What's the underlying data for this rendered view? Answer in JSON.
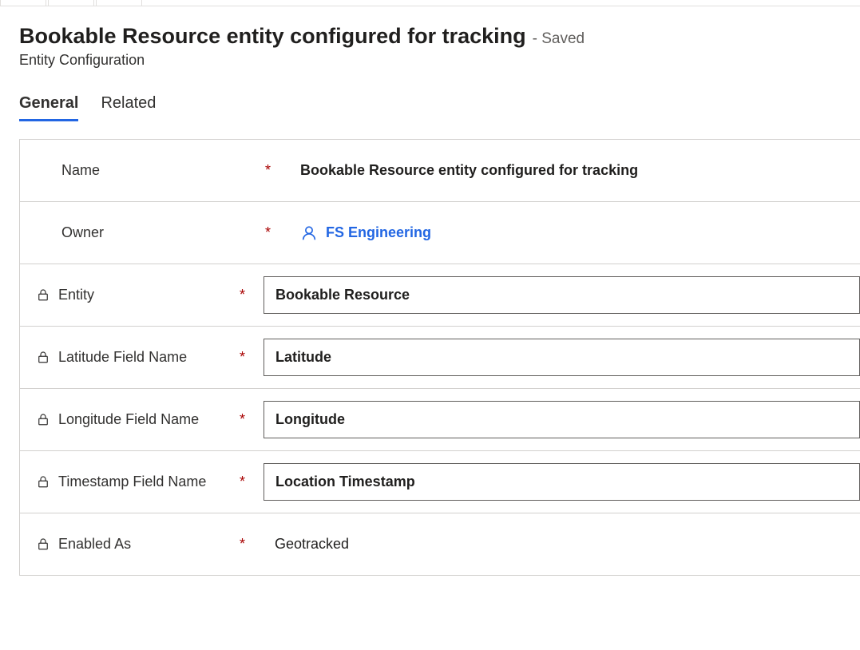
{
  "header": {
    "title": "Bookable Resource entity configured for tracking",
    "status": "- Saved",
    "subtitle": "Entity Configuration"
  },
  "tabs": {
    "general": "General",
    "related": "Related"
  },
  "form": {
    "name": {
      "label": "Name",
      "value": "Bookable Resource entity configured for tracking"
    },
    "owner": {
      "label": "Owner",
      "value": "FS Engineering"
    },
    "entity": {
      "label": "Entity",
      "value": "Bookable Resource"
    },
    "latitude": {
      "label": "Latitude Field Name",
      "value": "Latitude"
    },
    "longitude": {
      "label": "Longitude Field Name",
      "value": "Longitude"
    },
    "timestamp": {
      "label": "Timestamp Field Name",
      "value": "Location Timestamp"
    },
    "enabledAs": {
      "label": "Enabled As",
      "value": "Geotracked"
    }
  },
  "required": "*"
}
